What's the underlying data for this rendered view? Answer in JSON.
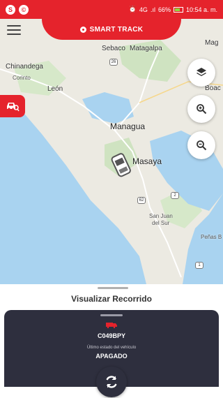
{
  "status_bar": {
    "app_icon_1": "S",
    "app_icon_2": "©",
    "network": "4G",
    "signal": ".ıl",
    "battery": "66%",
    "time": "10:54 a. m."
  },
  "header": {
    "title": "SMART TRACK"
  },
  "map": {
    "labels": {
      "managua": "Managua",
      "masaya": "Masaya",
      "chinandega": "Chinandega",
      "leon": "León",
      "corinto": "Corinto",
      "matagalpa": "Matagalpa",
      "sebaco": "Sebaco",
      "san_juan_del_sur_1": "San Juan",
      "san_juan_del_sur_2": "del Sur",
      "penas_blancas": "Peñas B",
      "boaco": "Boac",
      "mag": "Mag"
    },
    "shields": {
      "s26": "26",
      "s2": "2",
      "s1a": "1",
      "s62": "62",
      "s1b": "1",
      "s4": "4"
    }
  },
  "bottom_sheet": {
    "title": "Visualizar Recorrido",
    "plate": "C049BPY",
    "status_label": "Último estado del vehículo",
    "status_value": "APAGADO"
  },
  "colors": {
    "brand_red": "#e5232c",
    "card_dark": "#2e2f3e",
    "water": "#a9d3f0",
    "land": "#eceae2"
  }
}
